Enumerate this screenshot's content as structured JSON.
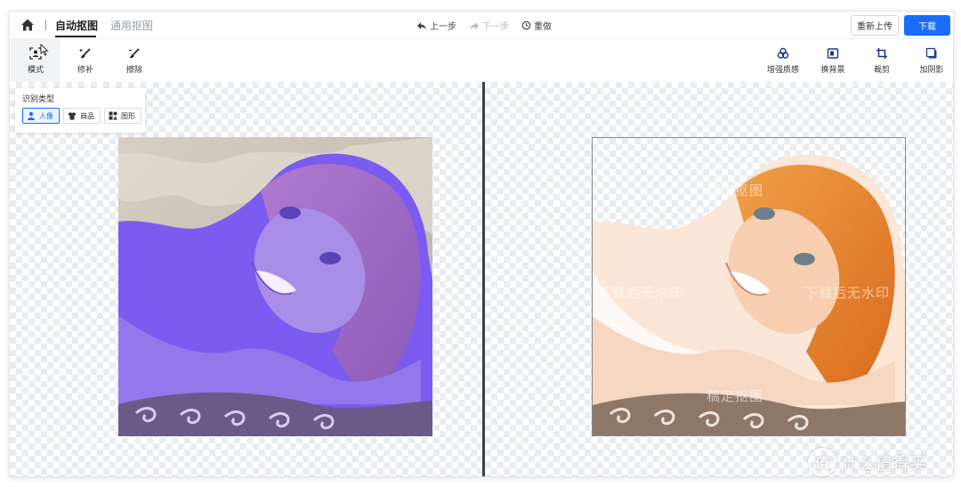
{
  "header": {
    "tabs": [
      {
        "label": "自动抠图",
        "active": true
      },
      {
        "label": "通用抠图",
        "active": false
      }
    ],
    "history": {
      "undo": "上一步",
      "redo": "下一步",
      "reset": "重做"
    },
    "reupload_label": "重新上传",
    "download_label": "下载"
  },
  "toolbar": {
    "left_tools": [
      {
        "label": "模式",
        "icon": "mode-icon",
        "active": true
      },
      {
        "label": "修补",
        "icon": "repair-brush-icon",
        "active": false
      },
      {
        "label": "擦除",
        "icon": "erase-brush-icon",
        "active": false
      }
    ],
    "right_tools": [
      {
        "label": "增强质感",
        "icon": "enhance-icon"
      },
      {
        "label": "换背景",
        "icon": "background-icon"
      },
      {
        "label": "裁剪",
        "icon": "crop-icon"
      },
      {
        "label": "加阴影",
        "icon": "shadow-icon"
      }
    ]
  },
  "recognition": {
    "title": "识别类型",
    "types": [
      {
        "label": "人像",
        "icon": "person-icon",
        "active": true
      },
      {
        "label": "商品",
        "icon": "shirt-icon",
        "active": false
      },
      {
        "label": "图形",
        "icon": "shapes-icon",
        "active": false
      }
    ]
  },
  "preview": {
    "watermarks": [
      "稿定抠图",
      "下载后无水印",
      "下载后无水印",
      "稿定抠图"
    ]
  },
  "site_logo": {
    "text": "什么值得买",
    "badge": "值"
  },
  "colors": {
    "accent": "#1a6cff",
    "mask": "#7b5cf0",
    "divider": "#3b3f46"
  }
}
